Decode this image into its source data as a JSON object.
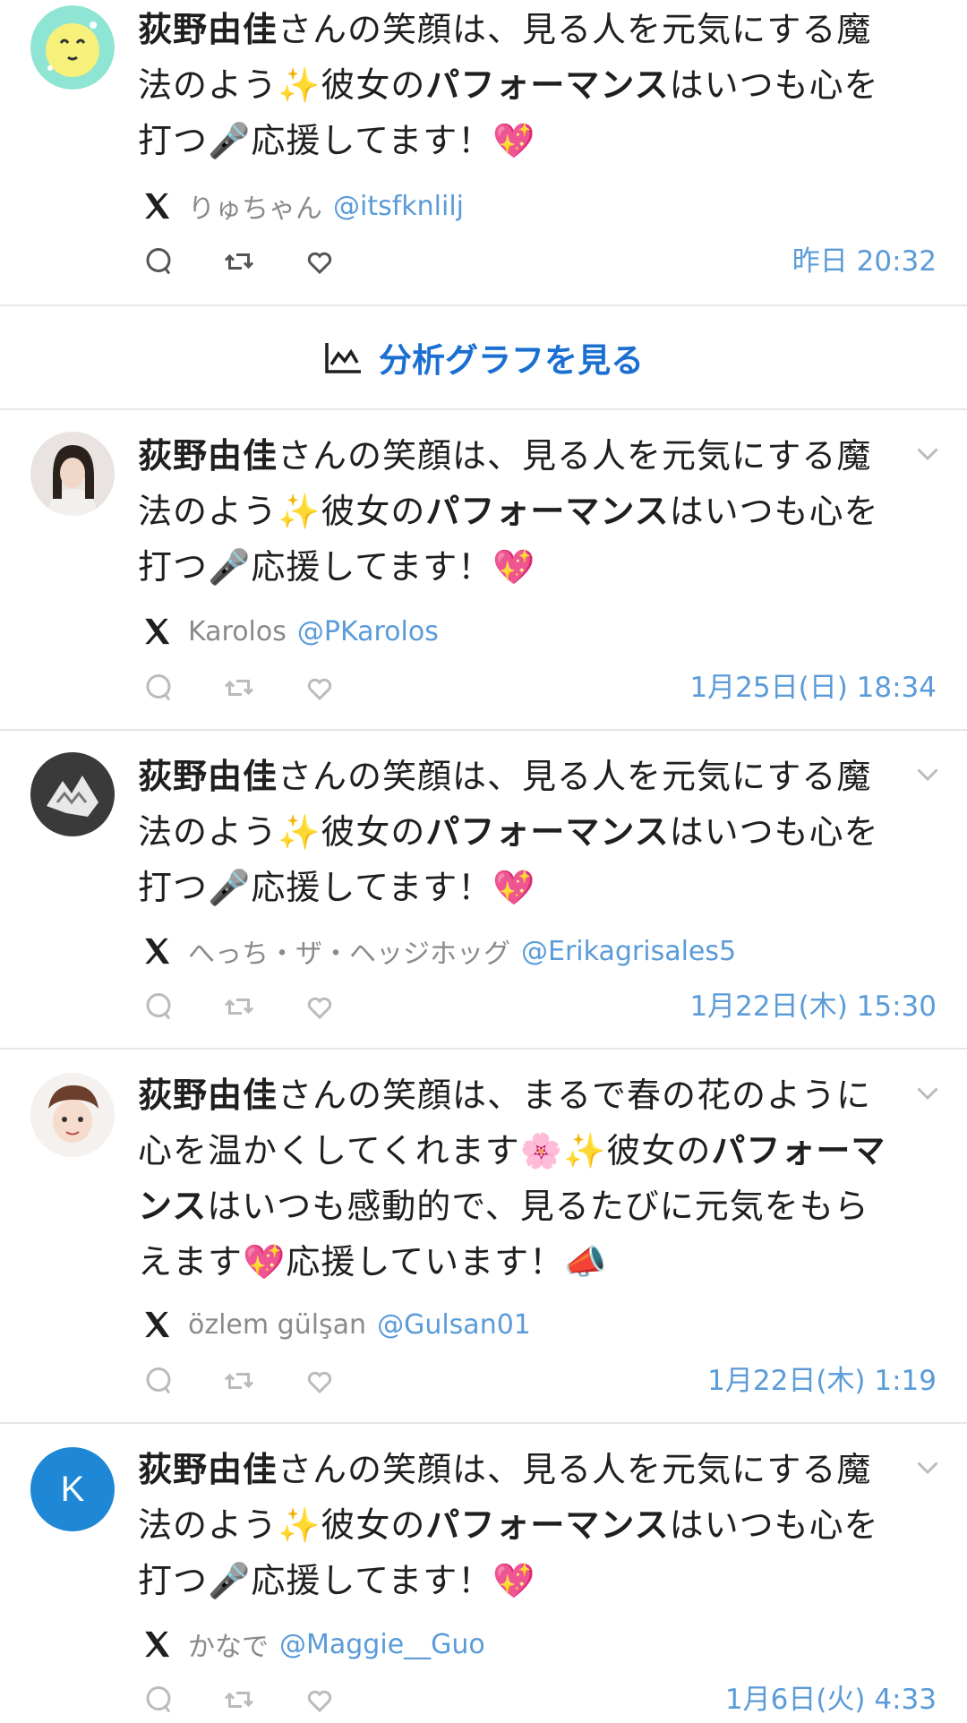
{
  "posts": [
    {
      "text_parts": [
        {
          "bold": true,
          "t": "荻野由佳"
        },
        {
          "bold": false,
          "t": "さんの笑顔は、見る人を元気にする魔法のよう✨彼女の"
        },
        {
          "bold": true,
          "t": "パフォーマンス"
        },
        {
          "bold": false,
          "t": "はいつも心を打つ🎤応援してます！💖"
        }
      ],
      "name": "りゅちゃん",
      "handle": "@itsfknlilj",
      "time": "昨日 20:32"
    },
    {
      "text_parts": [
        {
          "bold": true,
          "t": "荻野由佳"
        },
        {
          "bold": false,
          "t": "さんの笑顔は、見る人を元気にする魔法のよう✨彼女の"
        },
        {
          "bold": true,
          "t": "パフォーマンス"
        },
        {
          "bold": false,
          "t": "はいつも心を打つ🎤応援してます！💖"
        }
      ],
      "name": "Karolos",
      "handle": "@PKarolos",
      "time": "1月25日(日) 18:34"
    },
    {
      "text_parts": [
        {
          "bold": true,
          "t": "荻野由佳"
        },
        {
          "bold": false,
          "t": "さんの笑顔は、見る人を元気にする魔法のよう✨彼女の"
        },
        {
          "bold": true,
          "t": "パフォーマンス"
        },
        {
          "bold": false,
          "t": "はいつも心を打つ🎤応援してます！💖"
        }
      ],
      "name": "へっち・ザ・ヘッジホッグ",
      "handle": "@Erikagrisales5",
      "time": "1月22日(木) 15:30"
    },
    {
      "text_parts": [
        {
          "bold": true,
          "t": "荻野由佳"
        },
        {
          "bold": false,
          "t": "さんの笑顔は、まるで春の花のように心を温かくしてくれます🌸✨彼女の"
        },
        {
          "bold": true,
          "t": "パフォーマンス"
        },
        {
          "bold": false,
          "t": "はいつも感動的で、見るたびに元気をもらえます💖応援しています！📣"
        }
      ],
      "name": "özlem gülşan",
      "handle": "@Gulsan01",
      "time": "1月22日(木) 1:19"
    },
    {
      "text_parts": [
        {
          "bold": true,
          "t": "荻野由佳"
        },
        {
          "bold": false,
          "t": "さんの笑顔は、見る人を元気にする魔法のよう✨彼女の"
        },
        {
          "bold": true,
          "t": "パフォーマンス"
        },
        {
          "bold": false,
          "t": "はいつも心を打つ🎤応援してます！💖"
        }
      ],
      "name": "かなで",
      "handle": "@Maggie__Guo",
      "time": "1月6日(火) 4:33",
      "avatar_letter": "K"
    }
  ],
  "analysis_button": {
    "label": "分析グラフを見る",
    "icon": "chart-line-icon"
  },
  "colors": {
    "accent": "#1a6fd1",
    "link": "#5a9bd8",
    "muted": "#8a8a8a",
    "divider": "#e6e6e6",
    "avatar_k": "#1e88d6"
  }
}
